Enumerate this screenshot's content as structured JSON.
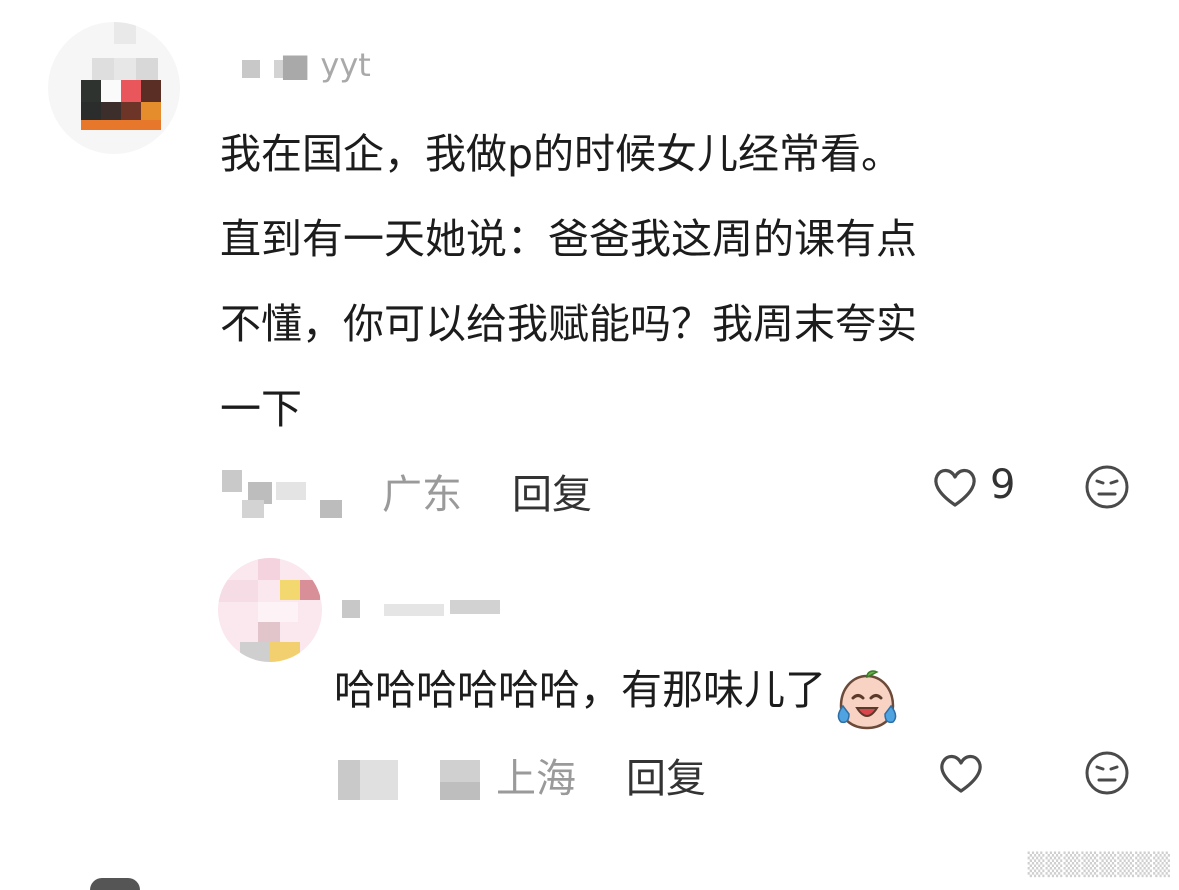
{
  "comments": [
    {
      "username": "■ yyt",
      "text": "我在国企，我做p的时候女儿经常看。\n直到有一天她说：爸爸我这周的课有点\n不懂，你可以给我赋能吗？我周末夸实\n一下",
      "location": "广东",
      "reply_label": "回复",
      "like_count": "9",
      "icons": [
        "heart-icon",
        "meh-face-icon"
      ]
    },
    {
      "username": "",
      "text": "哈哈哈哈哈哈，有那味儿了",
      "location": "上海",
      "reply_label": "回复",
      "like_count": "",
      "icons": [
        "heart-icon",
        "meh-face-icon",
        "laughing-crying-emoji-icon"
      ]
    }
  ],
  "colors": {
    "text": "#1c1c1c",
    "meta": "#9a9a9a",
    "icon": "#555555"
  }
}
